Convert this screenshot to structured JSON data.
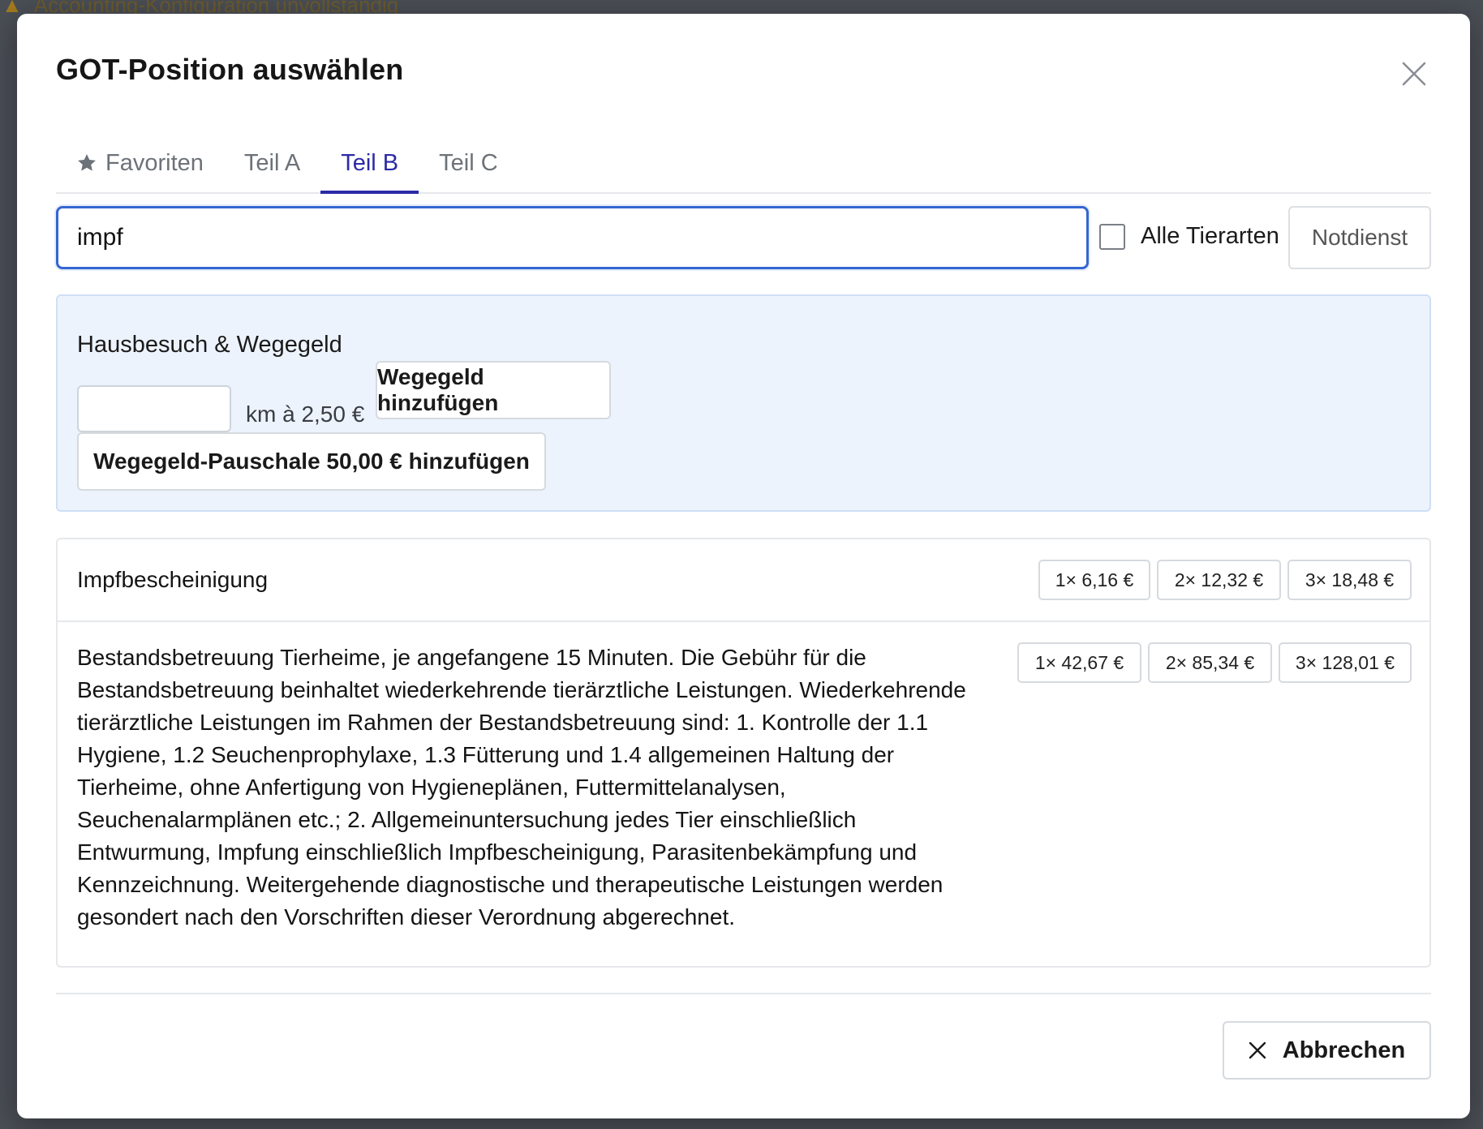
{
  "background": {
    "warning_text": "Accounting-Konfiguration unvollständig"
  },
  "modal": {
    "title": "GOT-Position auswählen",
    "tabs": [
      {
        "label": "Favoriten",
        "icon": "star-icon",
        "active": false
      },
      {
        "label": "Teil A",
        "active": false
      },
      {
        "label": "Teil B",
        "active": true
      },
      {
        "label": "Teil C",
        "active": false
      }
    ],
    "search": {
      "value": "impf",
      "placeholder": ""
    },
    "checkbox_label": "Alle Tierarten",
    "notdienst_label": "Notdienst",
    "hausbesuch": {
      "title": "Hausbesuch & Wegegeld",
      "km_value": "",
      "km_label": "km à 2,50 €",
      "add_label": "Wegegeld hinzufügen",
      "pauschale_label": "Wegegeld-Pauschale 50,00 € hinzufügen"
    },
    "results": [
      {
        "text": "Impfbescheinigung",
        "prices": [
          "1× 6,16 €",
          "2× 12,32 €",
          "3× 18,48 €"
        ]
      },
      {
        "text": "Bestandsbetreuung Tierheime, je angefangene 15 Minuten. Die Gebühr für die Bestandsbetreuung beinhaltet wiederkehrende tierärztliche Leistungen. Wiederkehrende tierärztliche Leistungen im Rahmen der Bestandsbetreuung sind: 1. Kontrolle der 1.1 Hygiene, 1.2 Seuchenprophylaxe, 1.3 Fütterung und 1.4 allgemeinen Haltung der Tierheime, ohne Anfertigung von Hygieneplänen, Futtermittelanalysen, Seuchenalarmplänen etc.; 2. Allgemeinuntersuchung jedes Tier einschließlich Entwurmung, Impfung einschließlich Impfbescheinigung, Parasitenbekämpfung und Kennzeichnung. Weitergehende diagnostische und therapeutische Leistungen werden gesondert nach den Vorschriften dieser Verordnung abgerechnet.",
        "prices": [
          "1× 42,67 €",
          "2× 85,34 €",
          "3× 128,01 €"
        ]
      }
    ],
    "cancel_label": "Abbrechen"
  },
  "colors": {
    "accent": "#2b2aa6",
    "focus": "#3466d1",
    "panel_bg": "#edf3fd"
  }
}
